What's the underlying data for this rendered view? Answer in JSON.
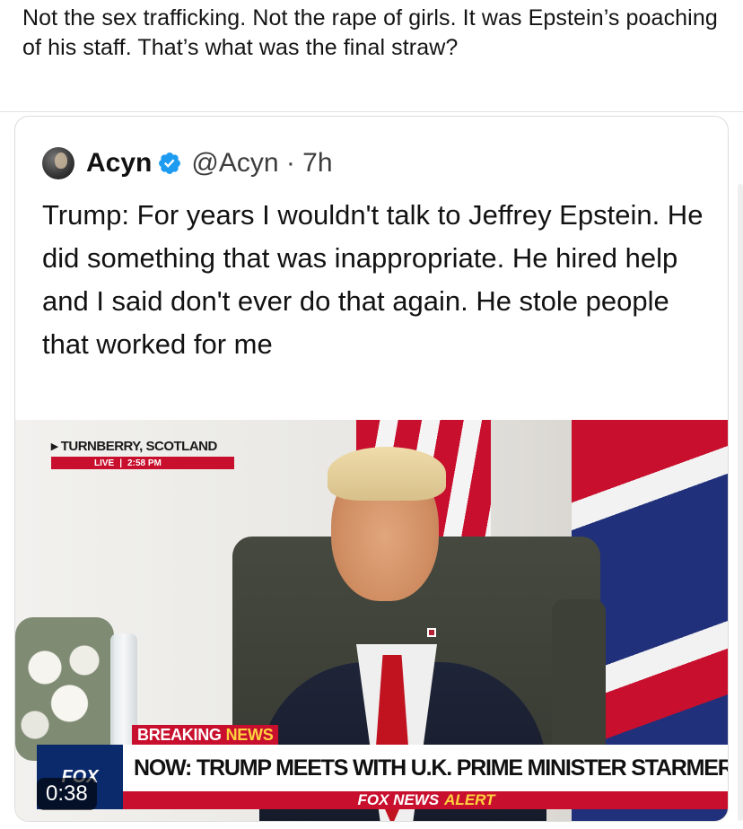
{
  "post": {
    "text": "Not the sex trafficking. Not the rape of girls. It was Epstein’s poaching of his staff. That’s what was the final straw?"
  },
  "quote": {
    "display_name": "Acyn",
    "handle_time": "@Acyn · 7h",
    "text": "Trump: For years I wouldn't talk to Jeffrey Epstein. He did something that was inappropriate. He hired help and I said don't ever do that again. He stole people that worked for me",
    "verified_icon": "verified-badge-icon",
    "verified_color": "#1d9bf0"
  },
  "video": {
    "location": "TURNBERRY, SCOTLAND",
    "live_label": "LIVE",
    "live_time": "2:58 PM",
    "breaking_word1": "BREAKING",
    "breaking_word2": "NEWS",
    "headline": "NOW: TRUMP MEETS WITH U.K. PRIME MINISTER STARMER",
    "network_logo": "FOX",
    "alert_prefix": "FOX NEWS",
    "alert_word": "ALERT",
    "duration": "0:38",
    "colors": {
      "fox_red": "#c8102e",
      "fox_yellow": "#ffd33d",
      "fox_blue": "#0b2a6b"
    }
  }
}
